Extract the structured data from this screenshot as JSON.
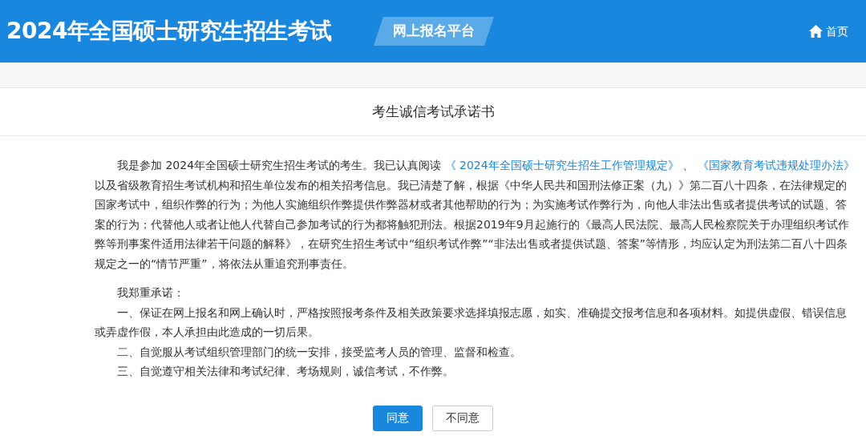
{
  "header": {
    "title": "2024年全国硕士研究生招生考试",
    "platform": "网上报名平台",
    "home": "首页"
  },
  "page_title": "考生诚信考试承诺书",
  "intro": [
    {
      "kind": "text",
      "text": "我是参加 2024年全国硕士研究生招生考试的考生。我已认真阅读 "
    },
    {
      "kind": "link",
      "text": "《 2024年全国硕士研究生招生工作管理规定》"
    },
    {
      "kind": "text",
      "text": " 、 "
    },
    {
      "kind": "link",
      "text": "《国家教育考试违规处理办法》"
    },
    {
      "kind": "text",
      "text": " 以及省级教育招生考试机构和招生单位发布的相关招考信息。我已清楚了解，根据《中华人民共和国刑法修正案（九）》第二百八十四条，在法律规定的国家考试中，组织作弊的行为；为他人实施组织作弊提供作弊器材或者其他帮助的行为；为实施考试作弊行为，向他人非法出售或者提供考试的试题、答案的行为；代替他人或者让他人代替自己参加考试的行为都将触犯刑法。根据2019年9月起施行的《最高人民法院、最高人民检察院关于办理组织考试作弊等刑事案件适用法律若干问题的解释》，在研究生招生考试中“组织考试作弊”“非法出售或者提供试题、答案”等情形，均应认定为刑法第二百八十四条规定之一的“情节严重”，将依法从重追究刑事责任。"
    }
  ],
  "pledge_heading": "我郑重承诺：",
  "pledges": [
    "一、保证在网上报名和网上确认时，严格按照报考条件及相关政策要求选择填报志愿，如实、准确提交报考信息和各项材料。如提供虚假、错误信息或弄虚作假，本人承担由此造成的一切后果。",
    "二、自觉服从考试组织管理部门的统一安排，接受监考人员的管理、监督和检查。",
    "三、自觉遵守相关法律和考试纪律、考场规则，诚信考试，不作弊。"
  ],
  "buttons": [
    {
      "label": "同意",
      "kind": "primary"
    },
    {
      "label": "不同意",
      "kind": "secondary"
    }
  ]
}
